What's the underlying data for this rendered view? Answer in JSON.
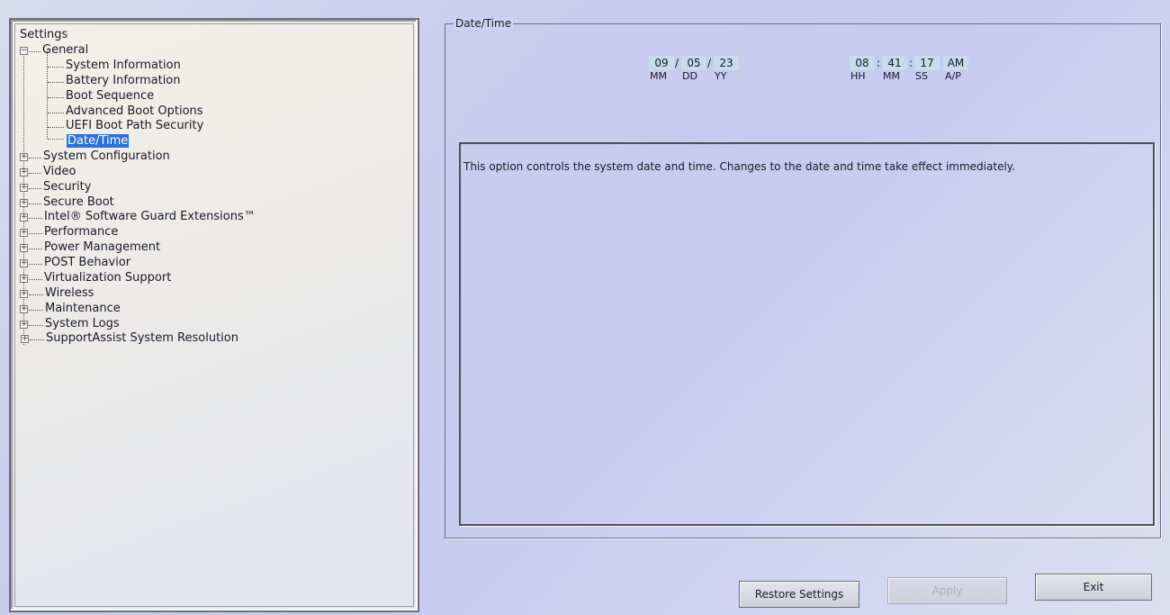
{
  "tree": {
    "root_label": "Settings",
    "general": {
      "label": "General",
      "children": [
        "System Information",
        "Battery Information",
        "Boot Sequence",
        "Advanced Boot Options",
        "UEFI Boot Path Security",
        "Date/Time"
      ],
      "selected": "Date/Time"
    },
    "categories": [
      "System Configuration",
      "Video",
      "Security",
      "Secure Boot",
      "Intel® Software Guard Extensions™",
      "Performance",
      "Power Management",
      "POST Behavior",
      "Virtualization Support",
      "Wireless",
      "Maintenance",
      "System Logs",
      "SupportAssist System Resolution"
    ],
    "expander_collapsed": "+",
    "expander_expanded": "−"
  },
  "datetime": {
    "group_title": "Date/Time",
    "date": {
      "mm": "09",
      "dd": "05",
      "yy": "23",
      "separator": "/"
    },
    "date_labels": {
      "mm": "MM",
      "dd": "DD",
      "yy": "YY"
    },
    "time": {
      "hh": "08",
      "mm": "41",
      "ss": "17",
      "ampm": "AM",
      "separator": ":"
    },
    "time_labels": {
      "hh": "HH",
      "mm": "MM",
      "ss": "SS",
      "ampm": "A/P"
    }
  },
  "description": "This option controls the system date and time. Changes to the date and time take effect immediately.",
  "buttons": {
    "restore": "Restore Settings",
    "apply": "Apply",
    "exit": "Exit"
  },
  "colors": {
    "selection": "#2a6fe0",
    "field_bg": "#c8dcec"
  }
}
